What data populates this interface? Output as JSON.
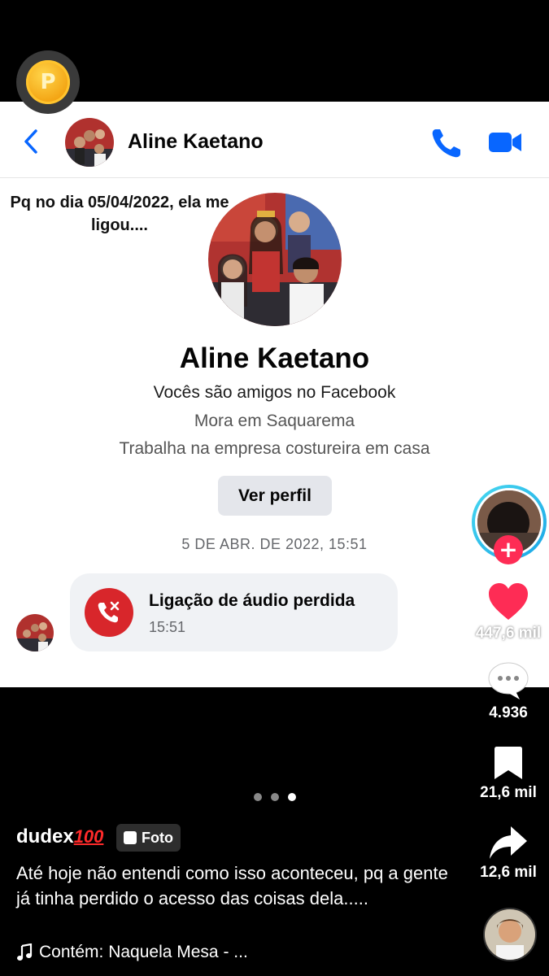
{
  "messenger": {
    "contact_name": "Aline Kaetano",
    "caption_overlay": "Pq no dia 05/04/2022, ela me ligou....",
    "profile": {
      "name": "Aline Kaetano",
      "friends_text": "Vocês são amigos no Facebook",
      "lives_text": "Mora em Saquarema",
      "works_text": "Trabalha na empresa costureira em casa",
      "view_profile_label": "Ver perfil"
    },
    "timestamp": "5 DE ABR. DE 2022, 15:51",
    "missed_call": {
      "title": "Ligação de áudio perdida",
      "time": "15:51"
    }
  },
  "tiktok": {
    "likes": "447,6 mil",
    "comments": "4.936",
    "saves": "21,6 mil",
    "shares": "12,6 mil",
    "username": "dudex",
    "username_emoji": "100",
    "badge_label": "Foto",
    "caption": "Até hoje não entendi como isso aconteceu, pq a gente já tinha perdido o acesso das coisas dela.....",
    "music": "Contém: Naquela Mesa - ...",
    "slide_count": 3,
    "active_slide": 3
  },
  "colors": {
    "messenger_blue": "#0866ff",
    "missed_red": "#d8262b",
    "tiktok_red": "#fe2c55",
    "coin_gold": "#f3a312"
  },
  "icons": [
    "coin-icon",
    "back-icon",
    "phone-icon",
    "video-camera-icon",
    "missed-call-icon",
    "heart-icon",
    "comment-icon",
    "bookmark-icon",
    "share-icon",
    "music-note-icon"
  ]
}
